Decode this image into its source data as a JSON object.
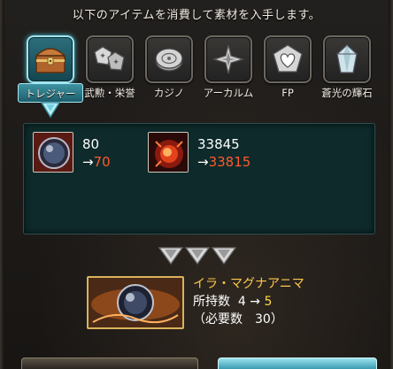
{
  "header": {
    "instruction": "以下のアイテムを消費して素材を入手します。"
  },
  "tabs": [
    {
      "label": "トレジャー",
      "icon": "treasure-chest-icon",
      "active": true
    },
    {
      "label": "武勲・栄誉",
      "icon": "medals-icon",
      "active": false
    },
    {
      "label": "カジノ",
      "icon": "casino-chip-icon",
      "active": false
    },
    {
      "label": "アーカルム",
      "icon": "arcarum-star-icon",
      "active": false
    },
    {
      "label": "FP",
      "icon": "fp-heart-icon",
      "active": false
    },
    {
      "label": "蒼光の輝石",
      "icon": "crystal-icon",
      "active": false
    }
  ],
  "consume": [
    {
      "icon": "orb-icon",
      "before": "80",
      "arrow": "→",
      "after": "70"
    },
    {
      "icon": "red-orb-icon",
      "before": "33845",
      "arrow": "→",
      "after": "33815"
    }
  ],
  "reward": {
    "icon": "anima-orb-icon",
    "name": "イラ・マグナアニマ",
    "owned_label": "所持数",
    "owned_from": "4",
    "arrow": "→",
    "owned_to": "5",
    "required_text": "（必要数　30）"
  },
  "colors": {
    "accent_teal": "#49c9de",
    "decrease_orange": "#ff5a2c",
    "gold": "#ffc84a"
  }
}
